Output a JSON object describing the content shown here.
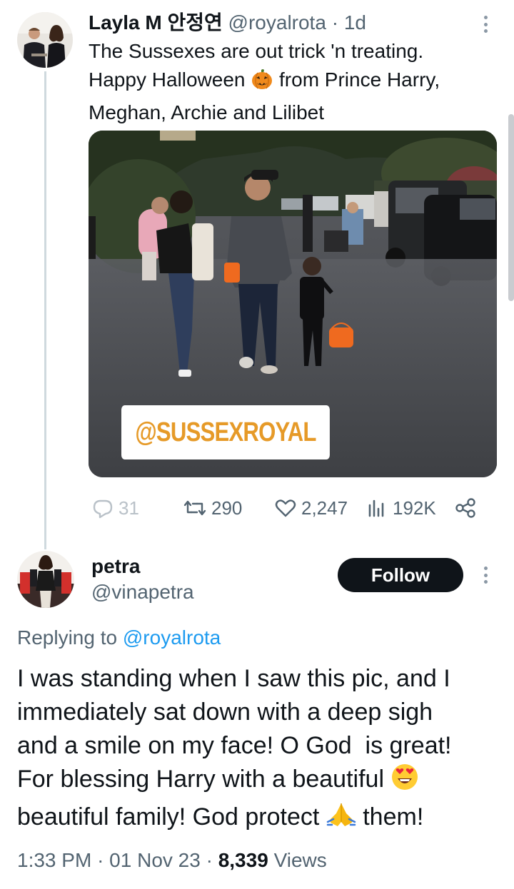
{
  "parent_tweet": {
    "display_name": "Layla M 안정연",
    "handle": "@royalrota",
    "separator": "·",
    "time_ago": "1d",
    "text_line1": "The Sussexes are out trick 'n treating.",
    "text_line2_before": "Happy Halloween ",
    "text_line2_emoji": "pumpkin-emoji",
    "text_line2_after": " from Prince Harry,",
    "text_line3": "Meghan, Archie and Lilibet",
    "photo_watermark": "@SUSSEXROYAL",
    "actions": {
      "replies": "31",
      "retweets": "290",
      "likes": "2,247",
      "views": "192K"
    }
  },
  "reply_tweet": {
    "display_name": "petra",
    "handle": "@vinapetra",
    "follow_label": "Follow",
    "replying_prefix": "Replying to",
    "replying_handle": "@royalrota",
    "text_line1": "I was standing when I saw this pic, and I",
    "text_line2": "immediately sat down with a deep sigh",
    "text_line3": "and a smile on my face! O God  is great!",
    "text_line4_before": "For blessing Harry with a beautiful ",
    "text_line4_emoji": "heart-eyes-emoji",
    "text_line5_before": "beautiful family! God protect ",
    "text_line5_emoji": "folded-hands-emoji",
    "text_line5_after": " them!",
    "time": "1:33 PM",
    "date": "01 Nov 23",
    "view_count": "8,339",
    "views_label": "Views"
  },
  "colors": {
    "text_primary": "#0f1419",
    "text_secondary": "#536471",
    "link": "#1d9bf0",
    "follow_bg": "#0f1419",
    "watermark": "#e69a28"
  }
}
